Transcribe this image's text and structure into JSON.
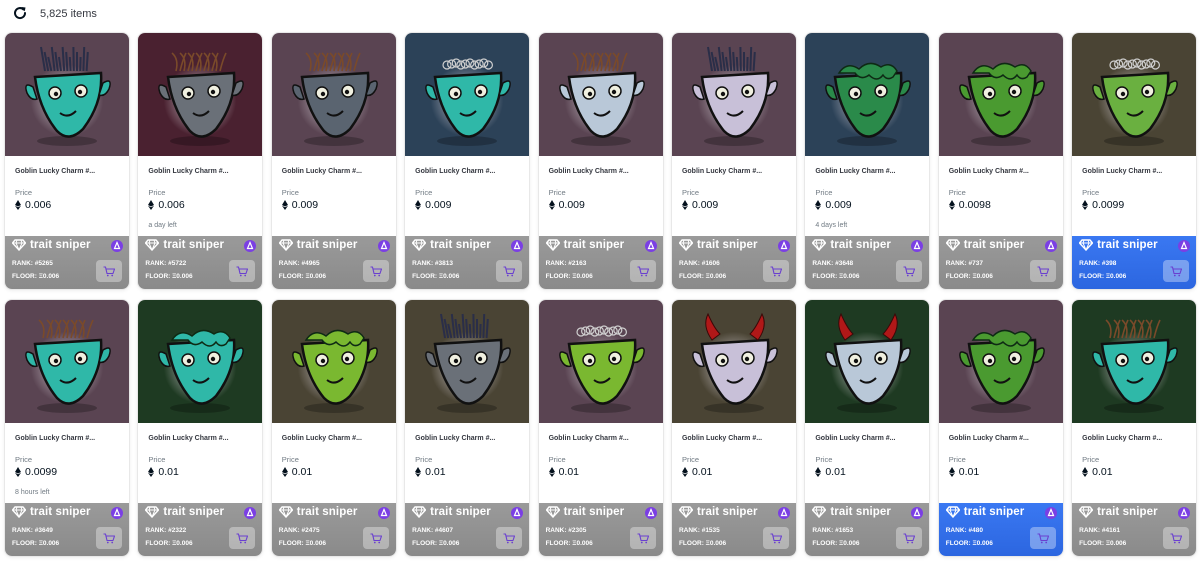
{
  "header": {
    "items_count": "5,825 items",
    "refresh_icon": "refresh-icon"
  },
  "colors": {
    "trait_bar_gray": "#8f8f8f",
    "trait_bar_blue": "#3172ec",
    "badge_purple": "#7b3fe4"
  },
  "cards": [
    {
      "name": "Goblin Lucky Charm #...",
      "price_label": "Price",
      "price": "0.006",
      "time": "",
      "brand": "trait sniper",
      "rank": "RANK: #5265",
      "floor": "FLOOR: Ξ0.006",
      "highlight": false,
      "bg": "#5a4452",
      "skin": "#2fb8a8",
      "hair": "spiky"
    },
    {
      "name": "Goblin Lucky Charm #...",
      "price_label": "Price",
      "price": "0.006",
      "time": "a day left",
      "brand": "trait sniper",
      "rank": "RANK: #5722",
      "floor": "FLOOR: Ξ0.006",
      "highlight": false,
      "bg": "#4a2130",
      "skin": "#6a7078",
      "hair": "messy"
    },
    {
      "name": "Goblin Lucky Charm #...",
      "price_label": "Price",
      "price": "0.009",
      "time": "",
      "brand": "trait sniper",
      "rank": "RANK: #4965",
      "floor": "FLOOR: Ξ0.006",
      "highlight": false,
      "bg": "#5a4452",
      "skin": "#5a6470",
      "hair": "messy"
    },
    {
      "name": "Goblin Lucky Charm #...",
      "price_label": "Price",
      "price": "0.009",
      "time": "",
      "brand": "trait sniper",
      "rank": "RANK: #3813",
      "floor": "FLOOR: Ξ0.006",
      "highlight": false,
      "bg": "#2c4258",
      "skin": "#2fb8a8",
      "hair": "wire"
    },
    {
      "name": "Goblin Lucky Charm #...",
      "price_label": "Price",
      "price": "0.009",
      "time": "",
      "brand": "trait sniper",
      "rank": "RANK: #2163",
      "floor": "FLOOR: Ξ0.006",
      "highlight": false,
      "bg": "#5a4452",
      "skin": "#b9c8d8",
      "hair": "messy"
    },
    {
      "name": "Goblin Lucky Charm #...",
      "price_label": "Price",
      "price": "0.009",
      "time": "",
      "brand": "trait sniper",
      "rank": "RANK: #1606",
      "floor": "FLOOR: Ξ0.006",
      "highlight": false,
      "bg": "#5a4452",
      "skin": "#c8c0d8",
      "hair": "spiky"
    },
    {
      "name": "Goblin Lucky Charm #...",
      "price_label": "Price",
      "price": "0.009",
      "time": "4 days left",
      "brand": "trait sniper",
      "rank": "RANK: #3648",
      "floor": "FLOOR: Ξ0.006",
      "highlight": false,
      "bg": "#2c4258",
      "skin": "#2a8a4a",
      "hair": "slime"
    },
    {
      "name": "Goblin Lucky Charm #...",
      "price_label": "Price",
      "price": "0.0098",
      "time": "",
      "brand": "trait sniper",
      "rank": "RANK: #737",
      "floor": "FLOOR: Ξ0.006",
      "highlight": false,
      "bg": "#5a4452",
      "skin": "#4a9a30",
      "hair": "slime"
    },
    {
      "name": "Goblin Lucky Charm #...",
      "price_label": "Price",
      "price": "0.0099",
      "time": "",
      "brand": "trait sniper",
      "rank": "RANK: #398",
      "floor": "FLOOR: Ξ0.006",
      "highlight": true,
      "bg": "#4a4434",
      "skin": "#6ab040",
      "hair": "wire"
    },
    {
      "name": "Goblin Lucky Charm #...",
      "price_label": "Price",
      "price": "0.0099",
      "time": "8 hours left",
      "brand": "trait sniper",
      "rank": "RANK: #3649",
      "floor": "FLOOR: Ξ0.006",
      "highlight": false,
      "bg": "#5a4452",
      "skin": "#2fb8a8",
      "hair": "messy"
    },
    {
      "name": "Goblin Lucky Charm #...",
      "price_label": "Price",
      "price": "0.01",
      "time": "",
      "brand": "trait sniper",
      "rank": "RANK: #2322",
      "floor": "FLOOR: Ξ0.006",
      "highlight": false,
      "bg": "#1e3a22",
      "skin": "#2fb8a8",
      "hair": "slime"
    },
    {
      "name": "Goblin Lucky Charm #...",
      "price_label": "Price",
      "price": "0.01",
      "time": "",
      "brand": "trait sniper",
      "rank": "RANK: #2475",
      "floor": "FLOOR: Ξ0.006",
      "highlight": false,
      "bg": "#4a4434",
      "skin": "#7ab830",
      "hair": "slime"
    },
    {
      "name": "Goblin Lucky Charm #...",
      "price_label": "Price",
      "price": "0.01",
      "time": "",
      "brand": "trait sniper",
      "rank": "RANK: #4607",
      "floor": "FLOOR: Ξ0.006",
      "highlight": false,
      "bg": "#4a4434",
      "skin": "#6a7078",
      "hair": "spiky"
    },
    {
      "name": "Goblin Lucky Charm #...",
      "price_label": "Price",
      "price": "0.01",
      "time": "",
      "brand": "trait sniper",
      "rank": "RANK: #2305",
      "floor": "FLOOR: Ξ0.006",
      "highlight": false,
      "bg": "#5a4452",
      "skin": "#7ab830",
      "hair": "wire"
    },
    {
      "name": "Goblin Lucky Charm #...",
      "price_label": "Price",
      "price": "0.01",
      "time": "",
      "brand": "trait sniper",
      "rank": "RANK: #1535",
      "floor": "FLOOR: Ξ0.006",
      "highlight": false,
      "bg": "#4a4434",
      "skin": "#c8c0d8",
      "hair": "horns"
    },
    {
      "name": "Goblin Lucky Charm #...",
      "price_label": "Price",
      "price": "0.01",
      "time": "",
      "brand": "trait sniper",
      "rank": "RANK: #1653",
      "floor": "FLOOR: Ξ0.006",
      "highlight": false,
      "bg": "#1e3a22",
      "skin": "#b9c8d8",
      "hair": "horns"
    },
    {
      "name": "Goblin Lucky Charm #...",
      "price_label": "Price",
      "price": "0.01",
      "time": "",
      "brand": "trait sniper",
      "rank": "RANK: #480",
      "floor": "FLOOR: Ξ0.006",
      "highlight": true,
      "bg": "#5a4452",
      "skin": "#4a9a30",
      "hair": "slime"
    },
    {
      "name": "Goblin Lucky Charm #...",
      "price_label": "Price",
      "price": "0.01",
      "time": "",
      "brand": "trait sniper",
      "rank": "RANK: #4161",
      "floor": "FLOOR: Ξ0.006",
      "highlight": false,
      "bg": "#1e3a22",
      "skin": "#2fb8a8",
      "hair": "messy"
    }
  ]
}
